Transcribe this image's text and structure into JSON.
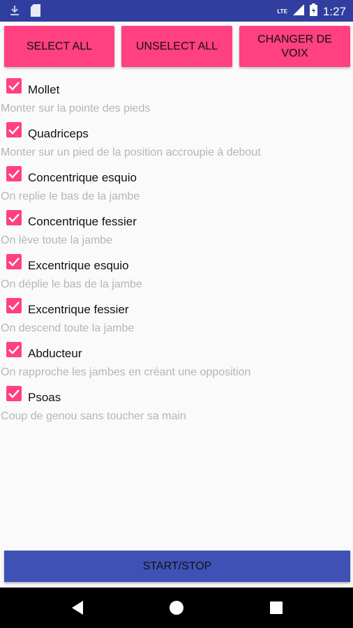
{
  "status_bar": {
    "network": "LTE",
    "time": "1:27"
  },
  "toolbar": {
    "select_all": "SELECT ALL",
    "unselect_all": "UNSELECT ALL",
    "change_voice": "CHANGER DE VOIX"
  },
  "exercises": [
    {
      "label": "Mollet",
      "description": "Monter sur la pointe des pieds",
      "checked": true
    },
    {
      "label": "Quadriceps",
      "description": "Monter sur un pied de la position accroupie à debout",
      "checked": true
    },
    {
      "label": "Concentrique esquio",
      "description": "On replie le bas de la jambe",
      "checked": true
    },
    {
      "label": "Concentrique fessier",
      "description": "On lève toute la jambe",
      "checked": true
    },
    {
      "label": "Excentrique esquio",
      "description": "On déplie le bas de la jambe",
      "checked": true
    },
    {
      "label": "Excentrique fessier",
      "description": "On descend toute la jambe",
      "checked": true
    },
    {
      "label": "Abducteur",
      "description": "On rapproche les jambes en créant une opposition",
      "checked": true
    },
    {
      "label": "Psoas",
      "description": "Coup de genou sans toucher sa main",
      "checked": true
    }
  ],
  "start_stop": "START/STOP",
  "colors": {
    "accent": "#ff4081",
    "primary": "#3f51b5",
    "primary_dark": "#303f9f"
  },
  "icons": [
    "download-icon",
    "sd-card-icon",
    "signal-icon",
    "battery-icon",
    "back-icon",
    "home-icon",
    "recents-icon"
  ]
}
